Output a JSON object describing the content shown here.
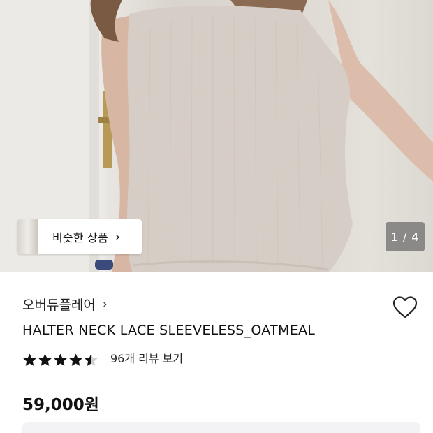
{
  "hero": {
    "similar_button_label": "비슷한 상품",
    "similar_chevron": "›",
    "page_counter": "1 / 4"
  },
  "product": {
    "brand": "오버듀플레어",
    "brand_chevron": "›",
    "title": "HALTER NECK LACE SLEEVELESS_OATMEAL",
    "rating": 4.5,
    "max_rating": 5,
    "review_link": "96개 리뷰 보기",
    "price": "59,000원"
  },
  "colors": {
    "star": "#111111",
    "text": "#111111",
    "box": "#f3f3f5"
  }
}
